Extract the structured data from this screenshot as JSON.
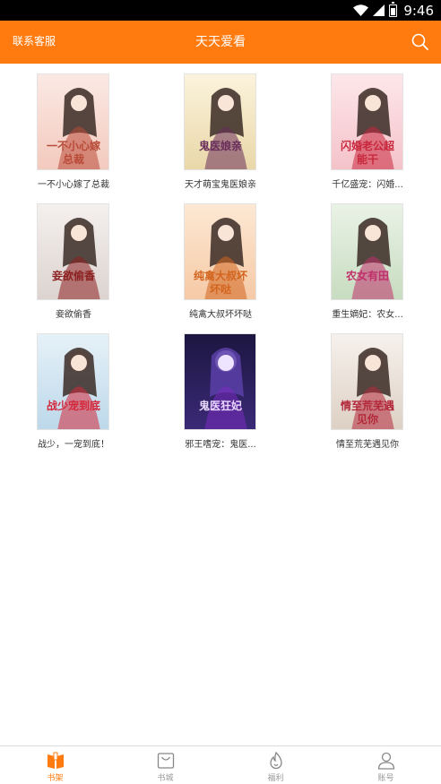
{
  "status_bar": {
    "time": "9:46",
    "icons": [
      "wifi-icon",
      "cell-signal-icon",
      "battery-icon"
    ]
  },
  "header": {
    "contact_label": "联系客服",
    "title": "天天爱看",
    "search_icon": "search-icon",
    "background": "#ff7b0f"
  },
  "books": [
    {
      "title": "一不小心嫁了总裁",
      "cover_text": "一不小心嫁总裁",
      "accent": "#b94a38"
    },
    {
      "title": "天才萌宝鬼医娘亲",
      "cover_text": "鬼医娘亲",
      "accent": "#6a2e5a"
    },
    {
      "title": "千亿盛宠：闪婚...",
      "cover_text": "闪婚老公超能干",
      "accent": "#c8273c"
    },
    {
      "title": "妾欲偷香",
      "cover_text": "妾欲偷香",
      "accent": "#8b1f1f"
    },
    {
      "title": "纯禽大叔坏坏哒",
      "cover_text": "纯禽大叔坏坏哒",
      "accent": "#d2641e"
    },
    {
      "title": "重生嫡妃：农女...",
      "cover_text": "农女有田",
      "accent": "#c0306a"
    },
    {
      "title": "战少，一宠到底！",
      "cover_text": "战少宠到底",
      "accent": "#d4283a"
    },
    {
      "title": "邪王嗜宠：鬼医...",
      "cover_text": "鬼医狂妃",
      "accent": "#7a2cc0"
    },
    {
      "title": "情至荒芜遇见你",
      "cover_text": "情至荒芜遇见你",
      "accent": "#b3283a"
    }
  ],
  "tabs": [
    {
      "label": "书架",
      "icon": "bookshelf-icon",
      "active": true
    },
    {
      "label": "书城",
      "icon": "bookstore-icon",
      "active": false
    },
    {
      "label": "福利",
      "icon": "welfare-flame-icon",
      "active": false
    },
    {
      "label": "账号",
      "icon": "account-icon",
      "active": false
    }
  ],
  "colors": {
    "accent": "#ff7b0f",
    "tab_inactive": "#999999",
    "text": "#333333"
  }
}
